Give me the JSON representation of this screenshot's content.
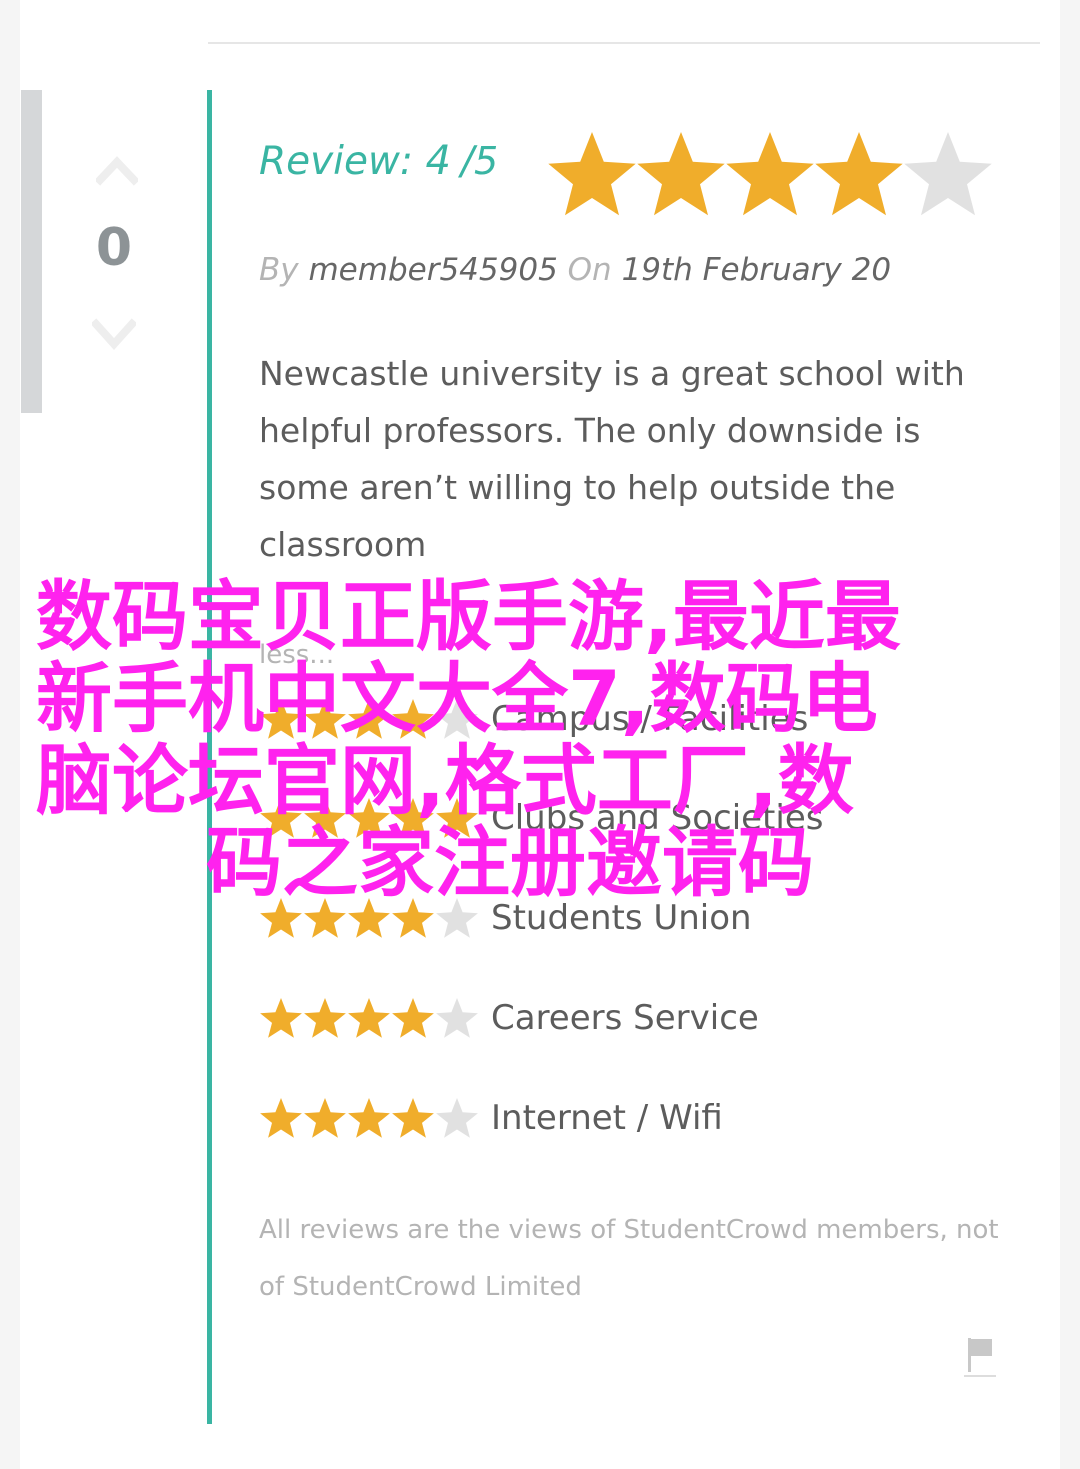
{
  "vote": {
    "count": "0",
    "up_icon": "chevron-up-icon",
    "down_icon": "chevron-down-icon"
  },
  "review": {
    "label": "Review:",
    "score": "4",
    "out_of": "5",
    "rating_value": 4,
    "rating_max": 5,
    "by_label": "By",
    "author": "member545905",
    "on_label": "On",
    "date": "19th February 20",
    "body": "Newcastle university is a great school with helpful professors. The only downside is some aren’t willing to help outside the classroom",
    "less_link": "less..."
  },
  "category_ratings": [
    {
      "label": "Campus / Facilities",
      "rating": 4
    },
    {
      "label": "Clubs and Societies",
      "rating": 5
    },
    {
      "label": "Students Union",
      "rating": 4
    },
    {
      "label": "Careers Service",
      "rating": 4
    },
    {
      "label": "Internet / Wifi",
      "rating": 4
    }
  ],
  "disclaimer": "All reviews are the views of StudentCrowd members, not of StudentCrowd Limited",
  "flag": {
    "icon": "flag-icon"
  },
  "overlay": {
    "lines": [
      "数码宝贝正版手游,最近最",
      "新手机中文大全7,数码电",
      "脑论坛官网,格式工厂,数",
      "码之家注册邀请码"
    ]
  },
  "colors": {
    "accent": "#3ab5a3",
    "star_filled": "#f0ad2b",
    "star_empty": "#e1e1e1",
    "overlay_text": "#ff22ee",
    "vote_bar": "#d5d7d9"
  }
}
